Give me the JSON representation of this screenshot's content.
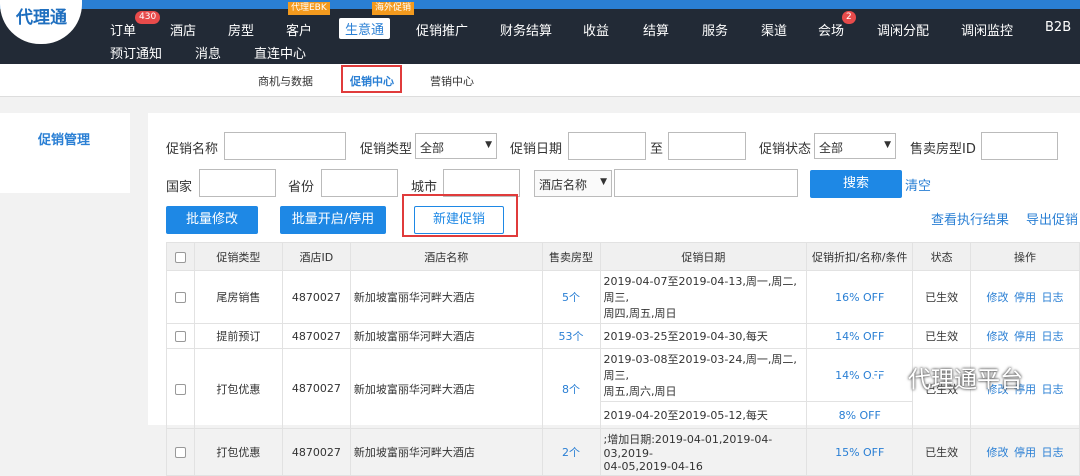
{
  "app": {
    "logo_text": "代理通"
  },
  "topnav": {
    "items": [
      {
        "label": "订单",
        "badge": "430"
      },
      {
        "label": "酒店"
      },
      {
        "label": "房型"
      },
      {
        "label": "客户",
        "tag": "代理EBK"
      },
      {
        "label": "生意通",
        "tag": "海外促销",
        "active": true
      },
      {
        "label": "促销推广"
      },
      {
        "label": "财务结算"
      },
      {
        "label": "收益"
      },
      {
        "label": "结算"
      },
      {
        "label": "服务"
      },
      {
        "label": "渠道"
      },
      {
        "label": "会场",
        "badge": "2"
      },
      {
        "label": "调闲分配"
      },
      {
        "label": "调闲监控"
      },
      {
        "label": "B2B"
      },
      {
        "label": "预订通知"
      },
      {
        "label": "消息"
      },
      {
        "label": "直连中心"
      }
    ]
  },
  "subnav": {
    "items": [
      "商机与数据",
      "促销中心",
      "营销中心"
    ],
    "active": "促销中心"
  },
  "sidebar": {
    "title": "促销管理"
  },
  "filters": {
    "promo_name_label": "促销名称",
    "promo_type_label": "促销类型",
    "promo_type_value": "全部",
    "promo_date_label": "促销日期",
    "to_label": "至",
    "promo_status_label": "促销状态",
    "promo_status_value": "全部",
    "room_type_id_label": "售卖房型ID",
    "country_label": "国家",
    "province_label": "省份",
    "city_label": "城市",
    "hotel_name_select": "酒店名称",
    "search_button": "搜索",
    "clear_link": "清空"
  },
  "actions": {
    "batch_edit": "批量修改",
    "batch_toggle": "批量开启/停用",
    "new_promo": "新建促销",
    "view_results": "查看执行结果",
    "export": "导出促销"
  },
  "table": {
    "headers": [
      "促销类型",
      "酒店ID",
      "酒店名称",
      "售卖房型",
      "促销日期",
      "促销折扣/名称/条件",
      "状态",
      "操作"
    ],
    "ops": [
      "修改",
      "停用",
      "日志"
    ],
    "rows": [
      {
        "type": "尾房销售",
        "hotel_id": "4870027",
        "hotel_name": "新加坡富丽华河畔大酒店",
        "rooms": "5个",
        "dates": [
          "2019-04-07至2019-04-13,周一,周二,周三,",
          "周四,周五,周日"
        ],
        "discount": "16% OFF",
        "status": "已生效"
      },
      {
        "type": "提前预订",
        "hotel_id": "4870027",
        "hotel_name": "新加坡富丽华河畔大酒店",
        "rooms": "53个",
        "dates": [
          "2019-03-25至2019-04-30,每天"
        ],
        "discount": "14% OFF",
        "status": "已生效"
      },
      {
        "type": "打包优惠",
        "hotel_id": "4870027",
        "hotel_name": "新加坡富丽华河畔大酒店",
        "rooms": "8个",
        "dates": [
          "2019-03-08至2019-03-24,周一,周二,周三,",
          "周五,周六,周日"
        ],
        "discount": "14% OFF",
        "status": "已生效",
        "dates2": "2019-04-20至2019-05-12,每天",
        "discount2": "8% OFF"
      },
      {
        "type": "打包优惠",
        "hotel_id": "4870027",
        "hotel_name": "新加坡富丽华河畔大酒店",
        "rooms": "2个",
        "dates": [
          ";增加日期:2019-04-01,2019-04-03,2019-",
          "04-05,2019-04-16"
        ],
        "discount": "15% OFF",
        "status": "已生效"
      }
    ]
  },
  "watermark": {
    "text": "代理通平台",
    "icon": "wechat-icon"
  }
}
